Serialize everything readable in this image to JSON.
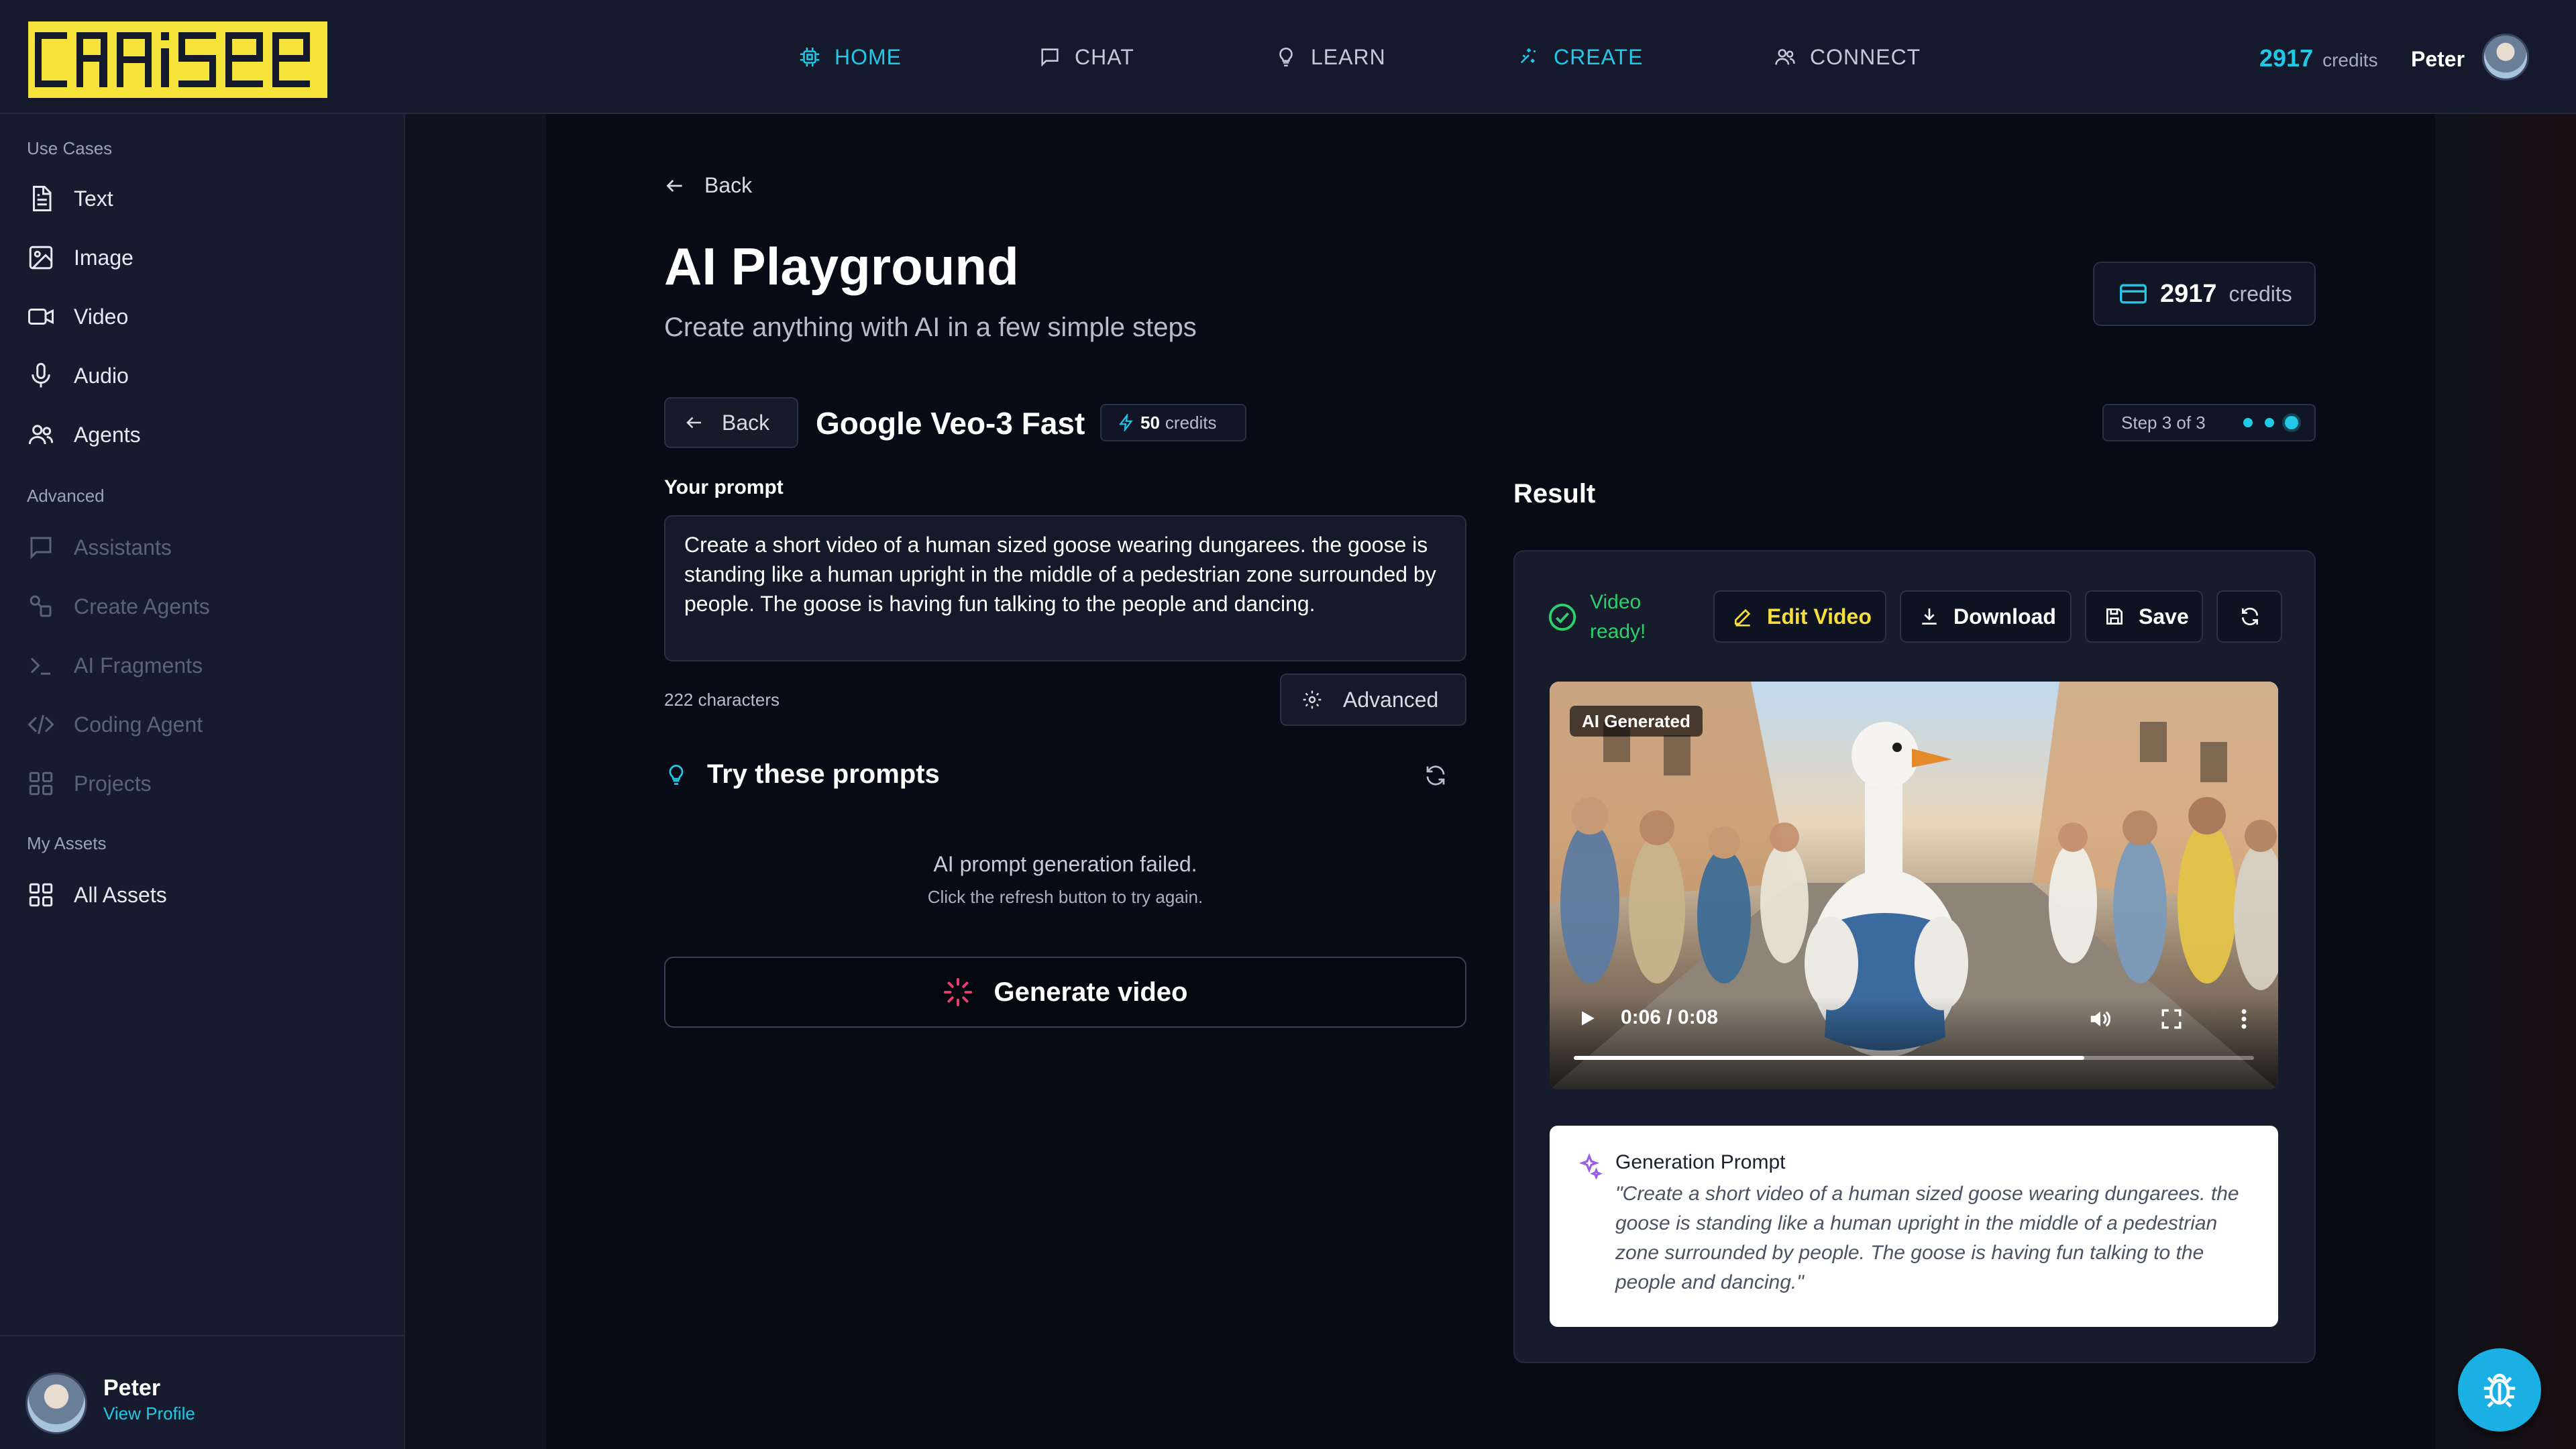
{
  "brand": {
    "logo_text": "CRAISEE",
    "accent": "#22c8e8",
    "logo_color": "#f6e43a"
  },
  "nav": [
    {
      "label": "HOME",
      "icon": "chip-icon",
      "active": true
    },
    {
      "label": "CHAT",
      "icon": "chat-icon",
      "active": false
    },
    {
      "label": "LEARN",
      "icon": "lightbulb-icon",
      "active": false
    },
    {
      "label": "CREATE",
      "icon": "sparkles-icon",
      "active": true
    },
    {
      "label": "CONNECT",
      "icon": "users-icon",
      "active": false
    }
  ],
  "header": {
    "credits_value": "2917",
    "credits_label": "credits",
    "user_name": "Peter"
  },
  "sidebar": {
    "use_cases_label": "Use Cases",
    "use_cases": [
      {
        "label": "Text",
        "icon": "document-icon"
      },
      {
        "label": "Image",
        "icon": "image-icon"
      },
      {
        "label": "Video",
        "icon": "video-icon"
      },
      {
        "label": "Audio",
        "icon": "microphone-icon"
      },
      {
        "label": "Agents",
        "icon": "users-icon"
      }
    ],
    "advanced_label": "Advanced",
    "advanced": [
      {
        "label": "Assistants",
        "icon": "chat-icon"
      },
      {
        "label": "Create Agents",
        "icon": "shapes-icon"
      },
      {
        "label": "AI Fragments",
        "icon": "terminal-icon"
      },
      {
        "label": "Coding Agent",
        "icon": "code-icon"
      },
      {
        "label": "Projects",
        "icon": "grid-icon"
      }
    ],
    "assets_label": "My Assets",
    "assets": [
      {
        "label": "All Assets",
        "icon": "grid-icon"
      }
    ],
    "footer": {
      "name": "Peter",
      "link": "View Profile"
    }
  },
  "page": {
    "back_label": "Back",
    "title": "AI Playground",
    "subtitle": "Create anything with AI in a few simple steps",
    "credits_value": "2917",
    "credits_label": "credits"
  },
  "model": {
    "back_label": "Back",
    "name": "Google Veo-3 Fast",
    "cost_value": "50",
    "cost_label": "credits",
    "step_label": "Step 3 of 3"
  },
  "prompt": {
    "label": "Your prompt",
    "value": "Create a short video of a human sized goose wearing dungarees. the goose is standing like a human upright in the middle of a pedestrian zone surrounded by people. The goose is having fun talking to the people and dancing.",
    "char_count": "222 characters",
    "advanced_label": "Advanced"
  },
  "suggestions": {
    "title": "Try these prompts",
    "error": "AI prompt generation failed.",
    "hint": "Click the refresh button to try again."
  },
  "generate_label": "Generate video",
  "result": {
    "label": "Result",
    "status": "Video ready!",
    "buttons": {
      "edit": "Edit Video",
      "download": "Download",
      "save": "Save"
    },
    "video": {
      "tag": "AI Generated",
      "time": "0:06 / 0:08",
      "progress": 0.75
    },
    "gen_prompt_title": "Generation Prompt",
    "gen_prompt_text": "\"Create a short video of a human sized goose wearing dungarees. the goose is standing like a human upright in the middle of a pedestrian zone surrounded by people. The goose is having fun talking to the people and dancing.\""
  }
}
